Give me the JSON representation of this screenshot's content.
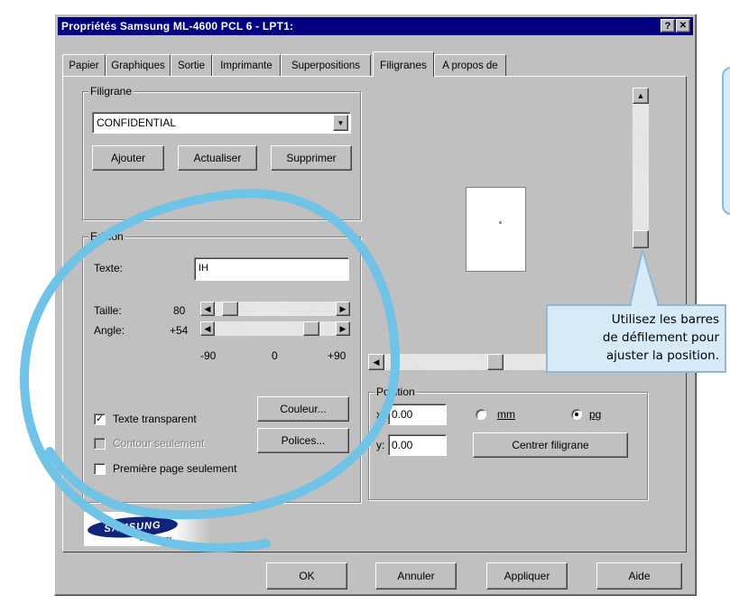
{
  "window": {
    "title": "Propriétés Samsung ML-4600 PCL 6 - LPT1:",
    "help_glyph": "?",
    "close_glyph": "✕"
  },
  "tabs": [
    {
      "label": "Papier"
    },
    {
      "label": "Graphiques"
    },
    {
      "label": "Sortie"
    },
    {
      "label": "Imprimante"
    },
    {
      "label": "Superpositions"
    },
    {
      "label": "Filigranes",
      "active": true
    },
    {
      "label": "A propos de"
    }
  ],
  "filigrane_group": {
    "label": "Filigrane",
    "selected": "CONFIDENTIAL",
    "buttons": {
      "add": "Ajouter",
      "update": "Actualiser",
      "delete": "Supprimer"
    }
  },
  "edition_group": {
    "label": "Edition",
    "text_label": "Texte:",
    "text_value": "IH",
    "size_label": "Taille:",
    "size_value": "80",
    "angle_label": "Angle:",
    "angle_value": "+54",
    "scale": {
      "min": "-90",
      "mid": "0",
      "max": "+90"
    },
    "transparent_label": "Texte transparent",
    "transparent_checked": true,
    "outline_label": "Contour seulement",
    "outline_checked": false,
    "first_page_label": "Première page seulement",
    "first_page_checked": false,
    "color_button": "Couleur...",
    "fonts_button": "Polices..."
  },
  "position_group": {
    "label": "Position",
    "x_label": "x:",
    "x_value": "0.00",
    "y_label": "y:",
    "y_value": "0.00",
    "unit_mm": "mm",
    "unit_pg": "pg",
    "selected_unit": "pg",
    "center_button": "Centrer filigrane"
  },
  "logo": {
    "brand": "SAMSUNG",
    "sub": "ELECTRONICS"
  },
  "bottom_buttons": {
    "ok": "OK",
    "cancel": "Annuler",
    "apply": "Appliquer",
    "help": "Aide"
  },
  "callout": {
    "line1": "Utilisez les barres",
    "line2": "de défilement pour",
    "line3": "ajuster la position."
  },
  "colors": {
    "title_bar": "#000080",
    "dialog_bg": "#c0c0c0",
    "callout_bg": "#d6ebf7",
    "callout_border": "#8fb8d8",
    "annotation_ring": "#6ec3e6"
  }
}
